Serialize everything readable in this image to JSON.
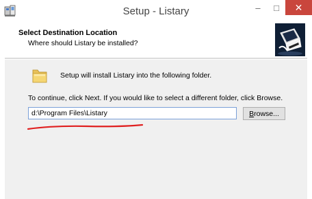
{
  "window": {
    "title": "Setup - Listary",
    "minimize_glyph": "–",
    "maximize_glyph": "□",
    "close_glyph": "✕"
  },
  "header": {
    "title": "Select Destination Location",
    "subtitle": "Where should Listary be installed?"
  },
  "content": {
    "install_text": "Setup will install Listary into the following folder.",
    "continue_text": "To continue, click Next. If you would like to select a different folder, click Browse.",
    "path_value": "d:\\Program Files\\Listary",
    "browse_first": "B",
    "browse_rest": "rowse..."
  },
  "icons": {
    "app": "setup-app-icon",
    "folder": "folder-icon",
    "logo": "setup-computer-logo"
  },
  "colors": {
    "close_button": "#c9463d",
    "annotation": "#e02020",
    "input_border": "#7aa0d8"
  }
}
